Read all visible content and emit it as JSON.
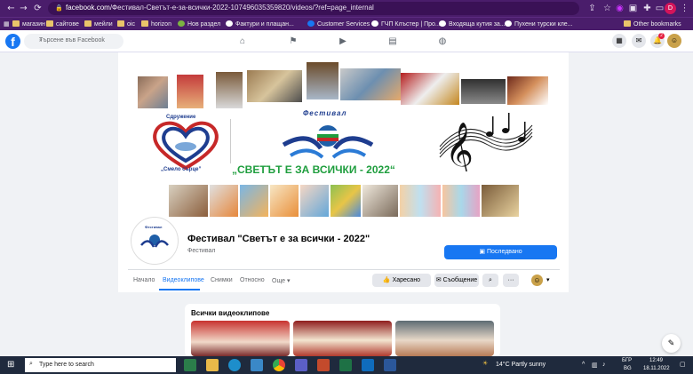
{
  "browser": {
    "url_domain": "facebook.com",
    "url_path": "/Фестивал-Светът-е-за-всички-2022-107496035359820/videos/?ref=page_internal",
    "profile_initial": "D",
    "bookmarks": [
      "магазин",
      "сайтове",
      "мейли",
      "oic",
      "horizon",
      "Нов раздел",
      "Фактури и плащан...",
      "Customer Services",
      "ГЧП Клъстер | Про...",
      "Входяща кутия за...",
      "Пухени турски кле..."
    ],
    "other_bookmarks": "Other bookmarks"
  },
  "facebook": {
    "logo": "f",
    "search_placeholder": "Търсене във Facebook",
    "notification_count": "2"
  },
  "cover": {
    "org_label": "Сдружение",
    "org_name": "„Смело сърце”",
    "festival_word": "Фестивал",
    "festival_title": "„СВЕТЪТ Е ЗА ВСИЧКИ - 2022“"
  },
  "page": {
    "avatar_text": "Фестивал",
    "title": "Фестивал \"Светът е за всички - 2022\"",
    "category": "Фестивал",
    "follow_label": "Последвано",
    "tabs": [
      "Начало",
      "Видеоклипове",
      "Снимки",
      "Относно",
      "Още"
    ],
    "like_label": "Харесано",
    "message_label": "Съобщение"
  },
  "videos": {
    "section_title": "Всички видеоклипове"
  },
  "taskbar": {
    "search_placeholder": "Type here to search",
    "weather": "14°C  Partly sunny",
    "lang_top": "БГР",
    "lang_bottom": "BG",
    "time": "12:49",
    "date": "18.11.2022"
  },
  "colors": {
    "chrome": "#4a1d6b",
    "fb_blue": "#1877f2",
    "festival_green": "#1f9e3e",
    "heart_red": "#c62828",
    "heart_blue": "#1e3d8f"
  }
}
